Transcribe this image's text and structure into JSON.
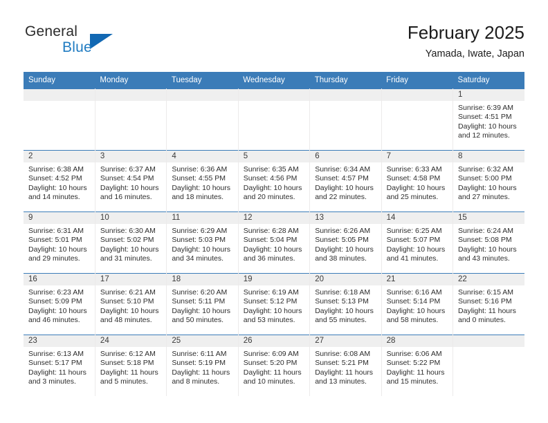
{
  "brand": {
    "name_part1": "General",
    "name_part2": "Blue",
    "color_dark": "#2b2b2b",
    "color_blue": "#1f7bc1",
    "triangle_color": "#1268b3"
  },
  "header": {
    "title": "February 2025",
    "subtitle": "Yamada, Iwate, Japan"
  },
  "theme": {
    "header_blue": "#3b7cb8",
    "daynum_band": "#efefef",
    "cell_bg": "#ffffff",
    "grid_line": "#eceaea"
  },
  "weekdays": [
    "Sunday",
    "Monday",
    "Tuesday",
    "Wednesday",
    "Thursday",
    "Friday",
    "Saturday"
  ],
  "weeks": [
    [
      {
        "day": "",
        "sunrise": "",
        "sunset": "",
        "daylight": "",
        "empty": true
      },
      {
        "day": "",
        "sunrise": "",
        "sunset": "",
        "daylight": "",
        "empty": true
      },
      {
        "day": "",
        "sunrise": "",
        "sunset": "",
        "daylight": "",
        "empty": true
      },
      {
        "day": "",
        "sunrise": "",
        "sunset": "",
        "daylight": "",
        "empty": true
      },
      {
        "day": "",
        "sunrise": "",
        "sunset": "",
        "daylight": "",
        "empty": true
      },
      {
        "day": "",
        "sunrise": "",
        "sunset": "",
        "daylight": "",
        "empty": true
      },
      {
        "day": "1",
        "sunrise": "Sunrise: 6:39 AM",
        "sunset": "Sunset: 4:51 PM",
        "daylight": "Daylight: 10 hours and 12 minutes."
      }
    ],
    [
      {
        "day": "2",
        "sunrise": "Sunrise: 6:38 AM",
        "sunset": "Sunset: 4:52 PM",
        "daylight": "Daylight: 10 hours and 14 minutes."
      },
      {
        "day": "3",
        "sunrise": "Sunrise: 6:37 AM",
        "sunset": "Sunset: 4:54 PM",
        "daylight": "Daylight: 10 hours and 16 minutes."
      },
      {
        "day": "4",
        "sunrise": "Sunrise: 6:36 AM",
        "sunset": "Sunset: 4:55 PM",
        "daylight": "Daylight: 10 hours and 18 minutes."
      },
      {
        "day": "5",
        "sunrise": "Sunrise: 6:35 AM",
        "sunset": "Sunset: 4:56 PM",
        "daylight": "Daylight: 10 hours and 20 minutes."
      },
      {
        "day": "6",
        "sunrise": "Sunrise: 6:34 AM",
        "sunset": "Sunset: 4:57 PM",
        "daylight": "Daylight: 10 hours and 22 minutes."
      },
      {
        "day": "7",
        "sunrise": "Sunrise: 6:33 AM",
        "sunset": "Sunset: 4:58 PM",
        "daylight": "Daylight: 10 hours and 25 minutes."
      },
      {
        "day": "8",
        "sunrise": "Sunrise: 6:32 AM",
        "sunset": "Sunset: 5:00 PM",
        "daylight": "Daylight: 10 hours and 27 minutes."
      }
    ],
    [
      {
        "day": "9",
        "sunrise": "Sunrise: 6:31 AM",
        "sunset": "Sunset: 5:01 PM",
        "daylight": "Daylight: 10 hours and 29 minutes."
      },
      {
        "day": "10",
        "sunrise": "Sunrise: 6:30 AM",
        "sunset": "Sunset: 5:02 PM",
        "daylight": "Daylight: 10 hours and 31 minutes."
      },
      {
        "day": "11",
        "sunrise": "Sunrise: 6:29 AM",
        "sunset": "Sunset: 5:03 PM",
        "daylight": "Daylight: 10 hours and 34 minutes."
      },
      {
        "day": "12",
        "sunrise": "Sunrise: 6:28 AM",
        "sunset": "Sunset: 5:04 PM",
        "daylight": "Daylight: 10 hours and 36 minutes."
      },
      {
        "day": "13",
        "sunrise": "Sunrise: 6:26 AM",
        "sunset": "Sunset: 5:05 PM",
        "daylight": "Daylight: 10 hours and 38 minutes."
      },
      {
        "day": "14",
        "sunrise": "Sunrise: 6:25 AM",
        "sunset": "Sunset: 5:07 PM",
        "daylight": "Daylight: 10 hours and 41 minutes."
      },
      {
        "day": "15",
        "sunrise": "Sunrise: 6:24 AM",
        "sunset": "Sunset: 5:08 PM",
        "daylight": "Daylight: 10 hours and 43 minutes."
      }
    ],
    [
      {
        "day": "16",
        "sunrise": "Sunrise: 6:23 AM",
        "sunset": "Sunset: 5:09 PM",
        "daylight": "Daylight: 10 hours and 46 minutes."
      },
      {
        "day": "17",
        "sunrise": "Sunrise: 6:21 AM",
        "sunset": "Sunset: 5:10 PM",
        "daylight": "Daylight: 10 hours and 48 minutes."
      },
      {
        "day": "18",
        "sunrise": "Sunrise: 6:20 AM",
        "sunset": "Sunset: 5:11 PM",
        "daylight": "Daylight: 10 hours and 50 minutes."
      },
      {
        "day": "19",
        "sunrise": "Sunrise: 6:19 AM",
        "sunset": "Sunset: 5:12 PM",
        "daylight": "Daylight: 10 hours and 53 minutes."
      },
      {
        "day": "20",
        "sunrise": "Sunrise: 6:18 AM",
        "sunset": "Sunset: 5:13 PM",
        "daylight": "Daylight: 10 hours and 55 minutes."
      },
      {
        "day": "21",
        "sunrise": "Sunrise: 6:16 AM",
        "sunset": "Sunset: 5:14 PM",
        "daylight": "Daylight: 10 hours and 58 minutes."
      },
      {
        "day": "22",
        "sunrise": "Sunrise: 6:15 AM",
        "sunset": "Sunset: 5:16 PM",
        "daylight": "Daylight: 11 hours and 0 minutes."
      }
    ],
    [
      {
        "day": "23",
        "sunrise": "Sunrise: 6:13 AM",
        "sunset": "Sunset: 5:17 PM",
        "daylight": "Daylight: 11 hours and 3 minutes."
      },
      {
        "day": "24",
        "sunrise": "Sunrise: 6:12 AM",
        "sunset": "Sunset: 5:18 PM",
        "daylight": "Daylight: 11 hours and 5 minutes."
      },
      {
        "day": "25",
        "sunrise": "Sunrise: 6:11 AM",
        "sunset": "Sunset: 5:19 PM",
        "daylight": "Daylight: 11 hours and 8 minutes."
      },
      {
        "day": "26",
        "sunrise": "Sunrise: 6:09 AM",
        "sunset": "Sunset: 5:20 PM",
        "daylight": "Daylight: 11 hours and 10 minutes."
      },
      {
        "day": "27",
        "sunrise": "Sunrise: 6:08 AM",
        "sunset": "Sunset: 5:21 PM",
        "daylight": "Daylight: 11 hours and 13 minutes."
      },
      {
        "day": "28",
        "sunrise": "Sunrise: 6:06 AM",
        "sunset": "Sunset: 5:22 PM",
        "daylight": "Daylight: 11 hours and 15 minutes."
      },
      {
        "day": "",
        "sunrise": "",
        "sunset": "",
        "daylight": "",
        "empty": true
      }
    ]
  ]
}
